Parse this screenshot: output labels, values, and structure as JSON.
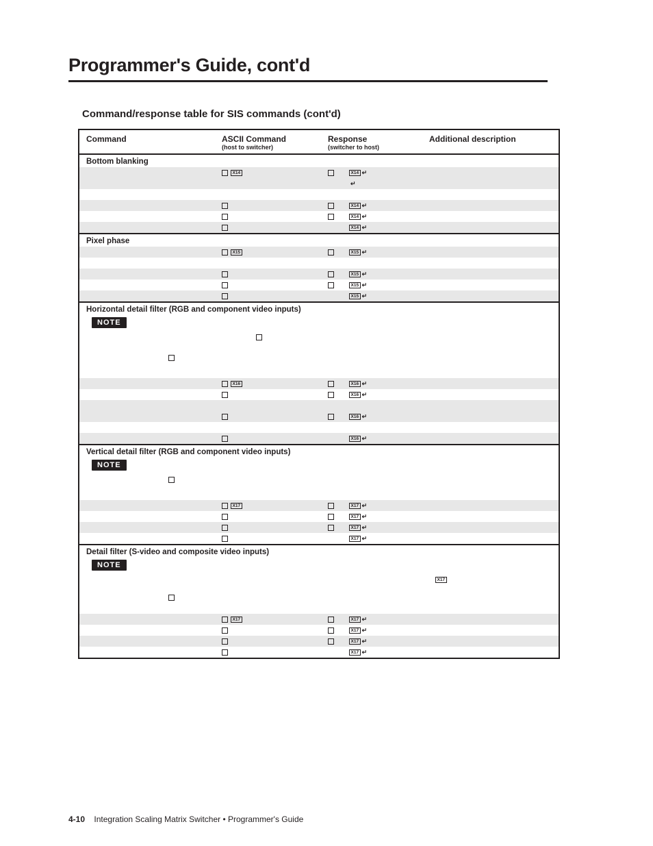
{
  "page_title": "Programmer's Guide, cont'd",
  "sub_title": "Command/response table for SIS commands (cont'd)",
  "headers": {
    "c1": "Command",
    "c2": "ASCII Command",
    "c2s": "(host to switcher)",
    "c3": "Response",
    "c3s": "(switcher to host)",
    "c4": "Additional description"
  },
  "sections": [
    {
      "title": "Bottom blanking",
      "rows": [
        {
          "g": true,
          "a": {
            "sq": true,
            "x": "X14"
          },
          "r": {
            "sq": true,
            "x": "X14",
            "cr": true
          }
        },
        {
          "g": true,
          "a": {},
          "r": {
            "cr": true
          }
        },
        {
          "a": {},
          "r": {}
        },
        {
          "g": true,
          "a": {
            "sq": true
          },
          "r": {
            "sq": true,
            "x": "X14",
            "cr": true
          }
        },
        {
          "a": {
            "sq": true
          },
          "r": {
            "sq": true,
            "x": "X14",
            "cr": true
          }
        },
        {
          "g": true,
          "a": {
            "sq": true
          },
          "r": {
            "x": "X14",
            "cr": true
          }
        }
      ]
    },
    {
      "title": "Pixel phase",
      "rows": [
        {
          "g": true,
          "a": {
            "sq": true,
            "x": "X15"
          },
          "r": {
            "sq": true,
            "x": "X15",
            "cr": true
          }
        },
        {
          "a": {},
          "r": {}
        },
        {
          "g": true,
          "a": {
            "sq": true
          },
          "r": {
            "sq": true,
            "x": "X15",
            "cr": true
          }
        },
        {
          "a": {
            "sq": true
          },
          "r": {
            "sq": true,
            "x": "X15",
            "cr": true
          }
        },
        {
          "g": true,
          "a": {
            "sq": true
          },
          "r": {
            "x": "X15",
            "cr": true
          }
        }
      ]
    },
    {
      "title": "Horizontal detail filter (RGB and component video inputs)",
      "note": true,
      "note_icons": [
        {
          "t": 374,
          "l": 258
        },
        {
          "t": 398,
          "l": 130
        }
      ],
      "rows": [
        {
          "g": true,
          "a": {
            "sq": true,
            "x": "X16"
          },
          "r": {
            "sq": true,
            "x": "X16",
            "cr": true
          }
        },
        {
          "a": {
            "sq": true
          },
          "r": {
            "sq": true,
            "x": "X16",
            "cr": true
          }
        },
        {
          "g": true,
          "a": {},
          "r": {}
        },
        {
          "g": true,
          "a": {
            "sq": true
          },
          "r": {
            "sq": true,
            "x": "X16",
            "cr": true
          }
        },
        {
          "a": {},
          "r": {}
        },
        {
          "g": true,
          "a": {
            "sq": true
          },
          "r": {
            "x": "X16",
            "cr": true
          }
        }
      ]
    },
    {
      "title": "Vertical detail filter (RGB and component video inputs)",
      "note": true,
      "note_icons": [
        {
          "t": 0,
          "l": 130
        }
      ],
      "rows": [
        {
          "g": true,
          "a": {
            "sq": true,
            "x": "X17"
          },
          "r": {
            "sq": true,
            "x": "X17",
            "cr": true
          }
        },
        {
          "a": {
            "sq": true
          },
          "r": {
            "sq": true,
            "x": "X17",
            "cr": true
          }
        },
        {
          "g": true,
          "a": {
            "sq": true
          },
          "r": {
            "sq": true,
            "x": "X17",
            "cr": true
          }
        },
        {
          "a": {
            "sq": true
          },
          "r": {
            "x": "X17",
            "cr": true
          }
        }
      ]
    },
    {
      "title": "Detail filter (S-video and composite video inputs)",
      "note": true,
      "note_icons": [
        {
          "t": 0,
          "l": 0
        }
      ],
      "rt_x": "X17",
      "note_icons2": [
        {
          "l": 130
        }
      ],
      "rows": [
        {
          "g": true,
          "a": {
            "sq": true,
            "x": "X17"
          },
          "r": {
            "sq": true,
            "x": "X17",
            "cr": true
          }
        },
        {
          "a": {
            "sq": true
          },
          "r": {
            "sq": true,
            "x": "X17",
            "cr": true
          }
        },
        {
          "g": true,
          "a": {
            "sq": true
          },
          "r": {
            "sq": true,
            "x": "X17",
            "cr": true
          }
        },
        {
          "a": {
            "sq": true
          },
          "r": {
            "x": "X17",
            "cr": true
          }
        }
      ]
    }
  ],
  "footer": {
    "page": "4-10",
    "text": "Integration Scaling Matrix Switcher • Programmer's Guide"
  }
}
